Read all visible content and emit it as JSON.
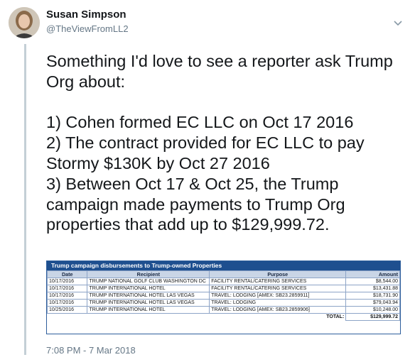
{
  "user": {
    "name": "Susan Simpson",
    "handle": "@TheViewFromLL2"
  },
  "tweet": {
    "text": "Something I'd love to see a reporter ask Trump Org about:\n\n1) Cohen formed EC LLC on Oct 17 2016\n2) The contract provided for EC LLC to pay Stormy $130K by Oct 27 2016\n3) Between Oct 17 & Oct 25, the Trump campaign made payments to Trump Org properties that add up to $129,999.72.",
    "timestamp": "7:08 PM - 7 Mar 2018"
  },
  "table": {
    "title": "Trump campaign disbursements to Trump-owned Properties",
    "headers": [
      "Date",
      "Recipient",
      "Purpose",
      "Amount"
    ],
    "rows": [
      [
        "10/17/2016",
        "TRUMP NATIONAL GOLF CLUB WASHINGTON DC",
        "FACILITY RENTAL/CATERING SERVICES",
        "$8,544.00"
      ],
      [
        "10/17/2016",
        "TRUMP INTERNATIONAL HOTEL",
        "FACILITY RENTAL/CATERING SERVICES",
        "$13,431.88"
      ],
      [
        "10/17/2016",
        "TRUMP INTERNATIONAL HOTEL LAS VEGAS",
        "TRAVEL: LODGING [AMEX: SB23.2859911]",
        "$18,731.90"
      ],
      [
        "10/17/2016",
        "TRUMP INTERNATIONAL HOTEL LAS VEGAS",
        "TRAVEL: LODGING",
        "$79,043.94"
      ],
      [
        "10/25/2016",
        "TRUMP INTERNATIONAL HOTEL",
        "TRAVEL: LODGING [AMEX: SB23.2859906]",
        "$10,248.00"
      ]
    ],
    "total_label": "TOTAL:",
    "total_value": "$129,999.72"
  },
  "colors": {
    "thread_line": "#c4cfd6",
    "table_header": "#1e4f8f",
    "secondary_text": "#657786"
  }
}
